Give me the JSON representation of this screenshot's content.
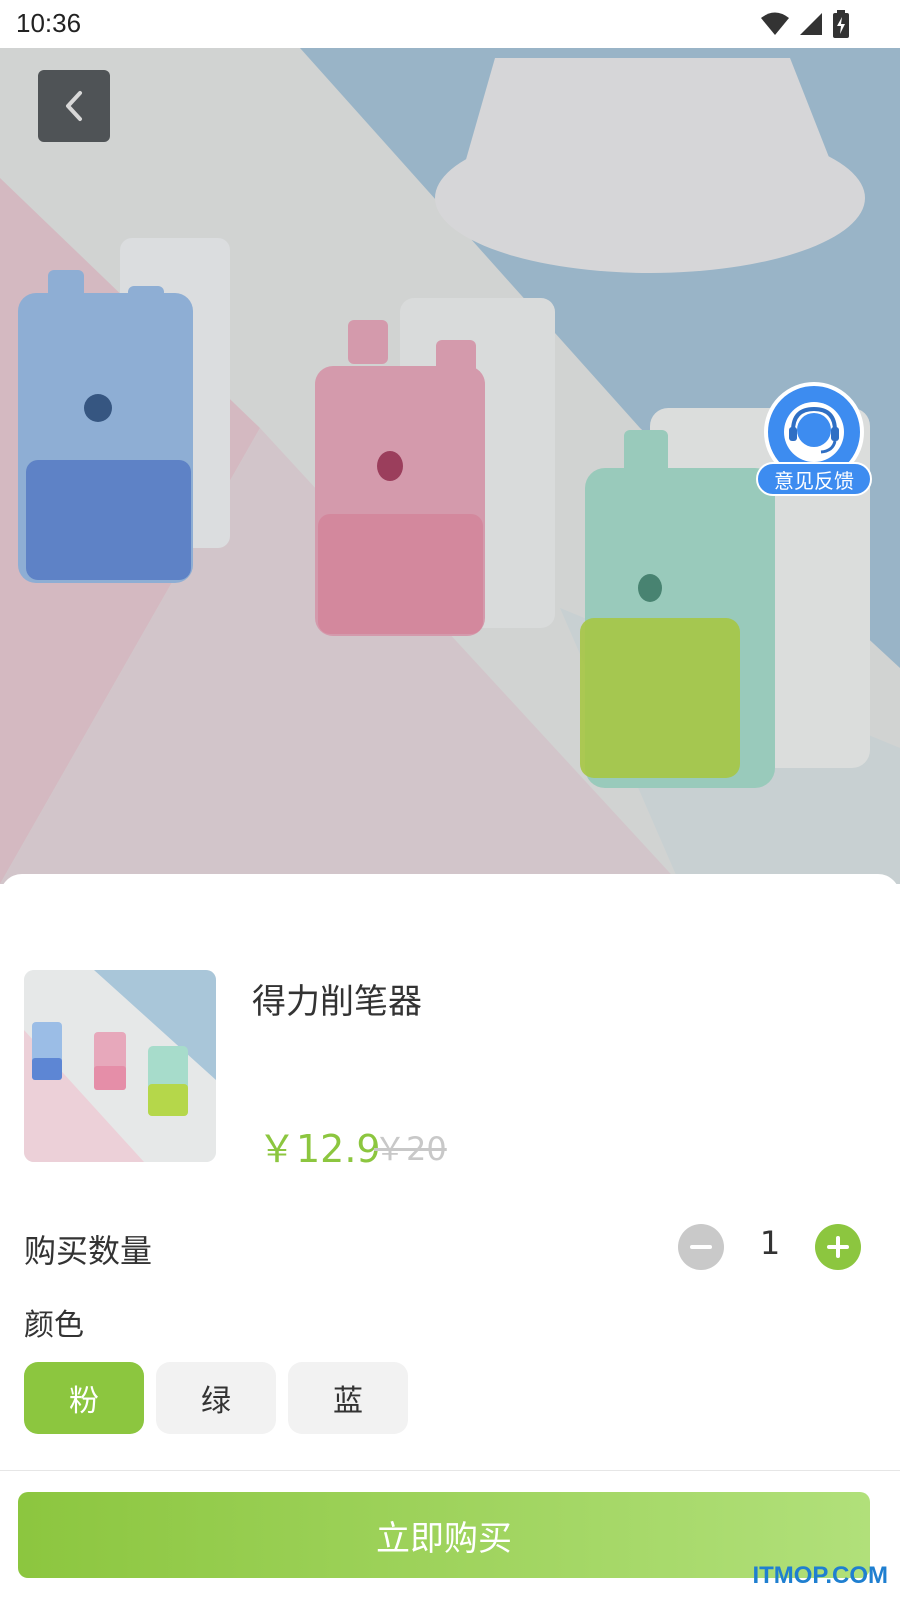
{
  "status_bar": {
    "time": "10:36"
  },
  "feedback": {
    "label": "意见反馈"
  },
  "product": {
    "name": "得力削笔器",
    "price_current": "￥12.9",
    "price_original": "￥20"
  },
  "quantity": {
    "label": "购买数量",
    "value": "1"
  },
  "color": {
    "label": "颜色",
    "options": [
      {
        "label": "粉",
        "selected": true
      },
      {
        "label": "绿",
        "selected": false
      },
      {
        "label": "蓝",
        "selected": false
      }
    ]
  },
  "buy_button": {
    "label": "立即购买"
  },
  "watermark": "ITMOP.COM",
  "colors": {
    "accent": "#8cc63f",
    "feedback": "#3d8cf0"
  }
}
